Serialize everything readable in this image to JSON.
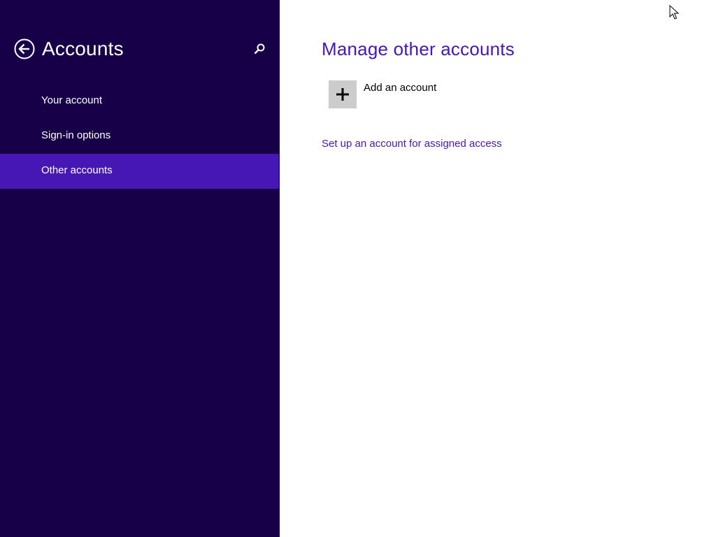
{
  "colors": {
    "sidebar_bg": "#180049",
    "accent": "#4617b4",
    "page_bg": "#ffffff",
    "tile_bg": "#cccccc"
  },
  "sidebar": {
    "back_icon": "back-arrow-icon",
    "title": "Accounts",
    "search_icon": "search-icon",
    "items": [
      {
        "label": "Your account",
        "selected": false
      },
      {
        "label": "Sign-in options",
        "selected": false
      },
      {
        "label": "Other accounts",
        "selected": true
      }
    ]
  },
  "main": {
    "title": "Manage other accounts",
    "add_account": {
      "icon": "plus-icon",
      "label": "Add an account"
    },
    "assigned_access_link": "Set up an account for assigned access"
  }
}
